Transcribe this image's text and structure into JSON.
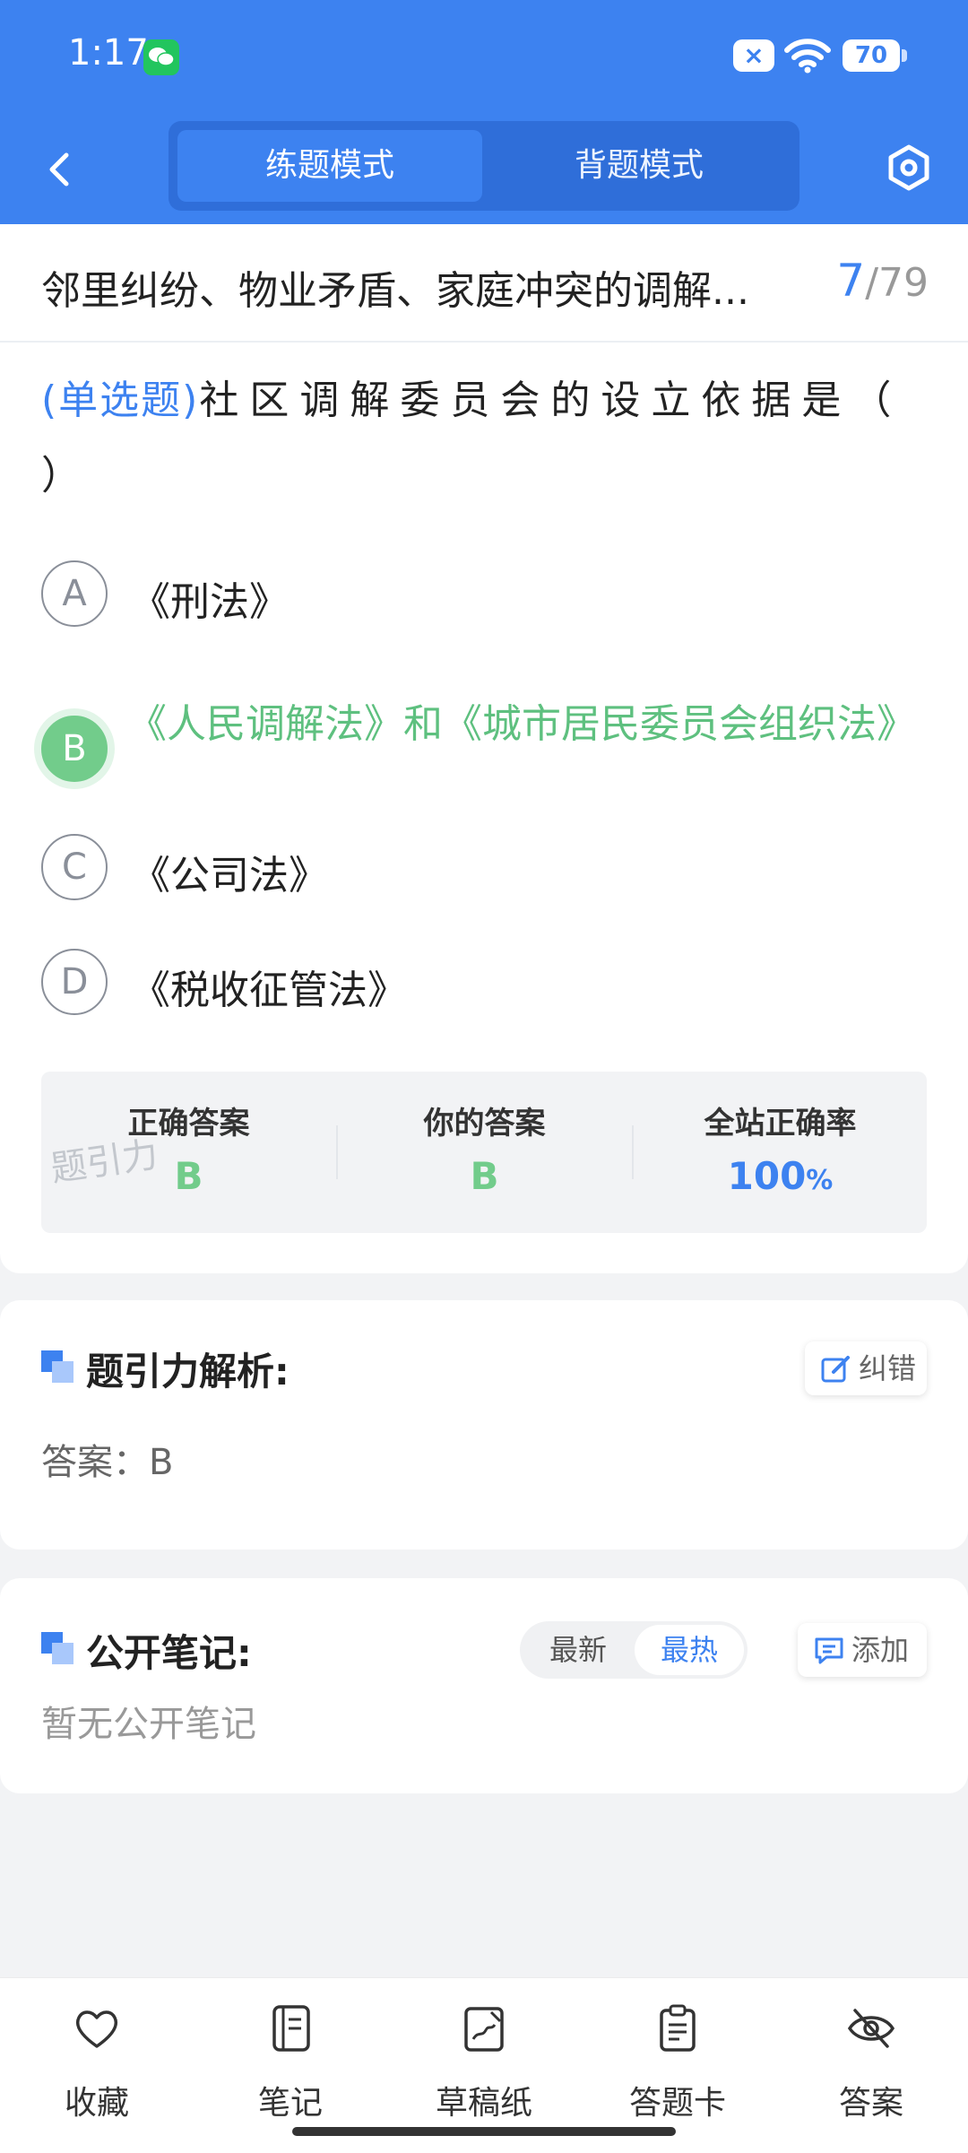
{
  "status_bar": {
    "time": "1:17",
    "battery": "70"
  },
  "nav": {
    "mode_practice": "练题模式",
    "mode_memorize": "背题模式"
  },
  "header": {
    "chapter_title": "邻里纠纷、物业矛盾、家庭冲突的调解...",
    "current": "7",
    "total": "/79"
  },
  "question": {
    "type": "(单选题)",
    "text": "社区调解委员会的设立依据是（ ）"
  },
  "options": [
    {
      "letter": "A",
      "text": "《刑法》"
    },
    {
      "letter": "B",
      "text": "《人民调解法》和《城市居民委员会组织法》"
    },
    {
      "letter": "C",
      "text": "《公司法》"
    },
    {
      "letter": "D",
      "text": "《税收征管法》"
    }
  ],
  "stats": {
    "correct_label": "正确答案",
    "correct_value": "B",
    "yours_label": "你的答案",
    "yours_value": "B",
    "rate_label": "全站正确率",
    "rate_value": "100",
    "rate_unit": "%",
    "watermark": "题引力"
  },
  "analysis": {
    "title": "题引力解析:",
    "report_label": "纠错",
    "answer_text": "答案：B"
  },
  "notes": {
    "title": "公开笔记:",
    "sort_latest": "最新",
    "sort_hot": "最热",
    "add_label": "添加",
    "empty_text": "暂无公开笔记"
  },
  "bottom_tabs": [
    {
      "label": "收藏",
      "icon": "heart-icon"
    },
    {
      "label": "笔记",
      "icon": "notebook-icon"
    },
    {
      "label": "草稿纸",
      "icon": "draft-icon"
    },
    {
      "label": "答题卡",
      "icon": "clipboard-icon"
    },
    {
      "label": "答案",
      "icon": "eye-off-icon"
    }
  ],
  "colors": {
    "accent": "#3d82f0",
    "correct": "#72cc8b"
  }
}
